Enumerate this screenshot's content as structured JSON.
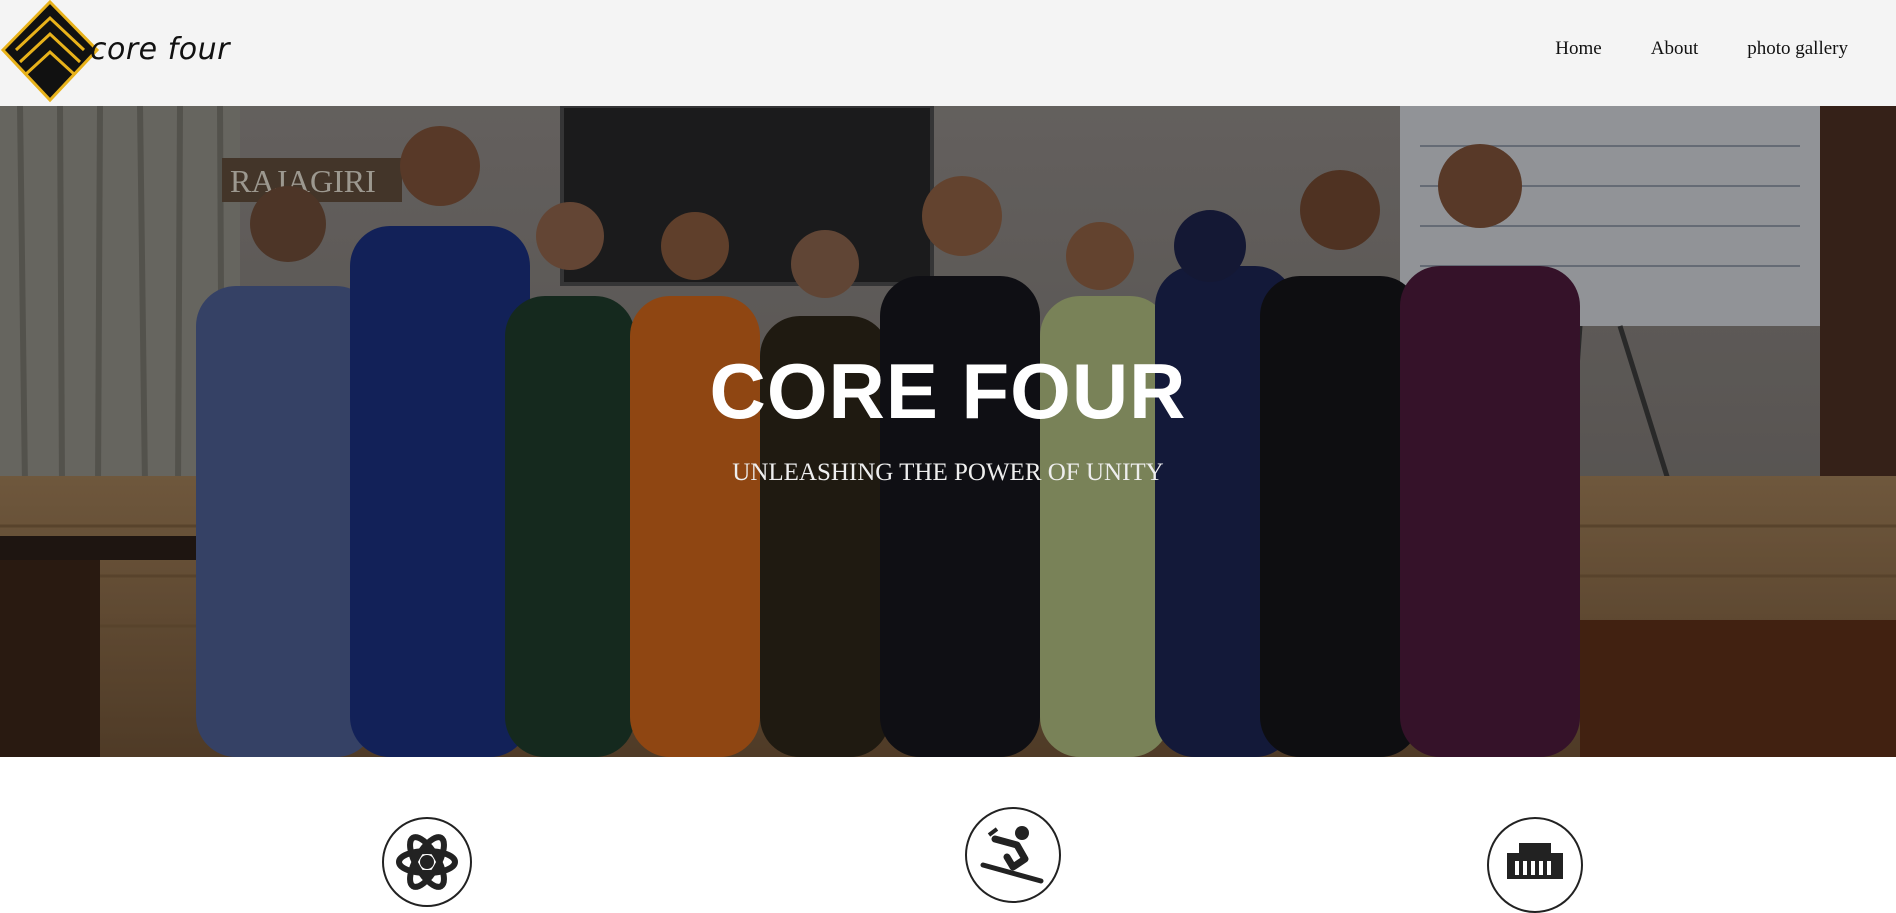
{
  "brand": {
    "name": "core four",
    "logo_icon": "layered-diamond-icon",
    "accent": "#e8b21a"
  },
  "nav": {
    "items": [
      {
        "label": "Home"
      },
      {
        "label": "About"
      },
      {
        "label": "photo gallery"
      }
    ]
  },
  "hero": {
    "title": "CORE FOUR",
    "subtitle": "UNLEASHING THE POWER OF UNITY",
    "background": "group-photo",
    "overlay_color": "#000000"
  },
  "features": [
    {
      "icon": "atom-icon"
    },
    {
      "icon": "skiing-icon"
    },
    {
      "icon": "ethernet-port-icon"
    }
  ]
}
